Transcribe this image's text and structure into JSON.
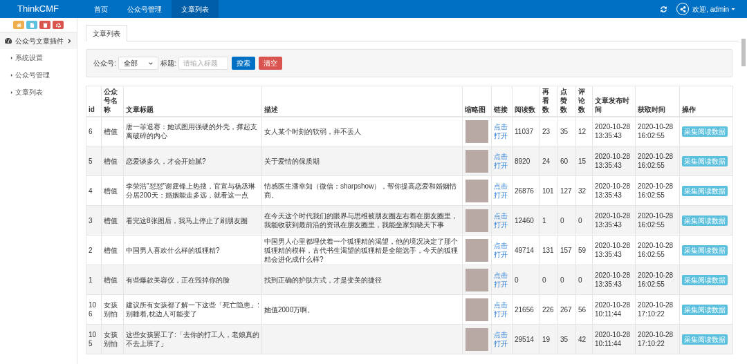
{
  "header": {
    "logo": "ThinkCMF",
    "nav": [
      {
        "label": "首页",
        "selected": false
      },
      {
        "label": "公众号管理",
        "selected": false
      },
      {
        "label": "文章列表",
        "selected": true
      }
    ],
    "user": "欢迎, admin"
  },
  "sidebar": {
    "toolbar": [
      {
        "kind": "home",
        "color": "#f0ad4e"
      },
      {
        "kind": "file",
        "color": "#5bc0de"
      },
      {
        "kind": "trash",
        "color": "#d9534f"
      },
      {
        "kind": "recycle",
        "color": "#d9534f"
      }
    ],
    "menu": {
      "label": "公众号文章插件",
      "children": [
        {
          "label": "系统设置"
        },
        {
          "label": "公众号管理"
        },
        {
          "label": "文章列表"
        }
      ]
    }
  },
  "tabs": [
    {
      "label": "文章列表",
      "selected": true
    }
  ],
  "filter": {
    "account_label": "公众号:",
    "account_value": "全部",
    "title_label": "标题:",
    "title_placeholder": "请输入标题",
    "search": "搜索",
    "clear": "清空"
  },
  "table": {
    "columns": [
      "id",
      "公众号名称",
      "文章标题",
      "描述",
      "缩略图",
      "链接",
      "阅读数",
      "再看数",
      "点赞数",
      "评论数",
      "文章发布时间",
      "获取时间",
      "操作"
    ],
    "rows": [
      {
        "id": "6",
        "account": "槽值",
        "title": "唐一菲退赛：她试图用强硬的外壳，撑起支离破碎的内心",
        "desc": "女人某个时刻的软弱，并不丢人",
        "link": "点击打开",
        "reads": "11037",
        "rewatch": "23",
        "likes": "35",
        "comments": "12",
        "published": "2020-10-28 13:35:43",
        "fetched": "2020-10-28 16:02:55",
        "action": "采集阅读数据"
      },
      {
        "id": "5",
        "account": "槽值",
        "title": "恋爱谈多久，才会开始腻?",
        "desc": "关于爱情的保质期",
        "link": "点击打开",
        "reads": "8920",
        "rewatch": "24",
        "likes": "60",
        "comments": "15",
        "published": "2020-10-28 13:35:43",
        "fetched": "2020-10-28 16:02:55",
        "action": "采集阅读数据"
      },
      {
        "id": "4",
        "account": "槽值",
        "title": "李荣浩\"怼怼\"谢霆锋上热搜，官宣与杨丞琳分居200天：婚姻能走多远，就看这一点",
        "desc": "情感医生潘幸知（微信：sharpshow），帮你提高恋爱和婚姻情商。",
        "link": "点击打开",
        "reads": "26876",
        "rewatch": "101",
        "likes": "127",
        "comments": "32",
        "published": "2020-10-28 13:35:43",
        "fetched": "2020-10-28 16:02:55",
        "action": "采集阅读数据"
      },
      {
        "id": "3",
        "account": "槽值",
        "title": "看完这8张图后，我马上停止了刷朋友圈",
        "desc": "在今天这个时代我们的眼界与思维被朋友圈左右着在朋友圈里，我能收获到最前沿的资讯在朋友圈里，我能坐家知晓天下事",
        "link": "点击打开",
        "reads": "12460",
        "rewatch": "1",
        "likes": "0",
        "comments": "0",
        "published": "2020-10-28 13:35:43",
        "fetched": "2020-10-28 16:02:55",
        "action": "采集阅读数据"
      },
      {
        "id": "2",
        "account": "槽值",
        "title": "中国男人喜欢什么样的狐狸精?",
        "desc": "中国男人心里都埋伏着一个狐狸精的渴望，他的境况决定了那个狐狸精的模样，古代书生渴望的狐狸精是全能选手，今天的狐狸精会进化成什么样?",
        "link": "点击打开",
        "reads": "49714",
        "rewatch": "131",
        "likes": "157",
        "comments": "59",
        "published": "2020-10-28 13:35:43",
        "fetched": "2020-10-28 16:02:55",
        "action": "采集阅读数据"
      },
      {
        "id": "1",
        "account": "槽值",
        "title": "有些爆款美容仪，正在毁掉你的脸",
        "desc": "找到正确的护肤方式，才是变美的捷径",
        "link": "点击打开",
        "reads": "0",
        "rewatch": "0",
        "likes": "0",
        "comments": "0",
        "published": "2020-10-28 13:35:43",
        "fetched": "2020-10-28 16:02:55",
        "action": "采集阅读数据"
      },
      {
        "id": "106",
        "account": "女孩别怕",
        "title": "建议所有女孩都了解一下这些「死亡隐患」:别睡着,枕边人可能变了",
        "desc": "她值2000万啊。",
        "link": "点击打开",
        "reads": "21656",
        "rewatch": "226",
        "likes": "267",
        "comments": "56",
        "published": "2020-10-28 10:11:44",
        "fetched": "2020-10-28 17:10:22",
        "action": "采集阅读数据"
      },
      {
        "id": "105",
        "account": "女孩别怕",
        "title": "这些女孩罢工了:「去你的打工人，老娘真的不去上班了」",
        "link": "点击打开",
        "reads": "29514",
        "rewatch": "19",
        "likes": "35",
        "comments": "42",
        "published": "2020-10-28 10:11:44",
        "fetched": "2020-10-28 17:10:22",
        "action": "采集阅读数据"
      }
    ]
  }
}
